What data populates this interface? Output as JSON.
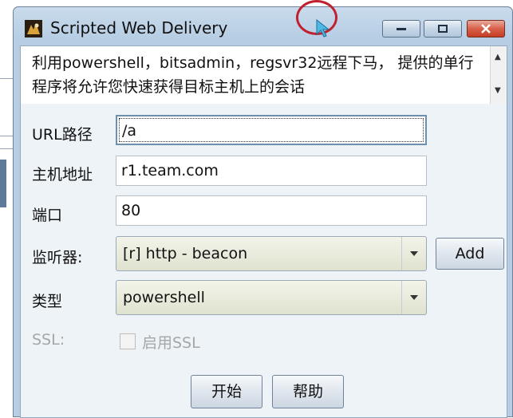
{
  "window": {
    "title": "Scripted Web Delivery"
  },
  "description": "利用powershell，bitsadmin，regsvr32远程下马， 提供的单行程序将允许您快速获得目标主机上的会话",
  "form": {
    "url_label": "URL路径",
    "url_value": "/a",
    "host_label": "主机地址",
    "host_value": "r1.team.com",
    "port_label": "端口",
    "port_value": "80",
    "listener_label": "监听器:",
    "listener_value": "[r] http - beacon",
    "add_label": "Add",
    "type_label": "类型",
    "type_value": "powershell",
    "ssl_label": "SSL:",
    "ssl_checkbox_label": "启用SSL",
    "ssl_enabled": false
  },
  "buttons": {
    "start_label": "开始",
    "help_label": "帮助"
  },
  "colors": {
    "titlebar": "#c9dbec",
    "close_button": "#d8604a",
    "combo_bg": "#dfe2cf",
    "cursor_ring": "#c1212e"
  },
  "icons": [
    "app-icon",
    "minimize-icon",
    "maximize-icon",
    "close-icon",
    "scroll-up-icon",
    "scroll-down-icon",
    "chevron-down-icon"
  ]
}
